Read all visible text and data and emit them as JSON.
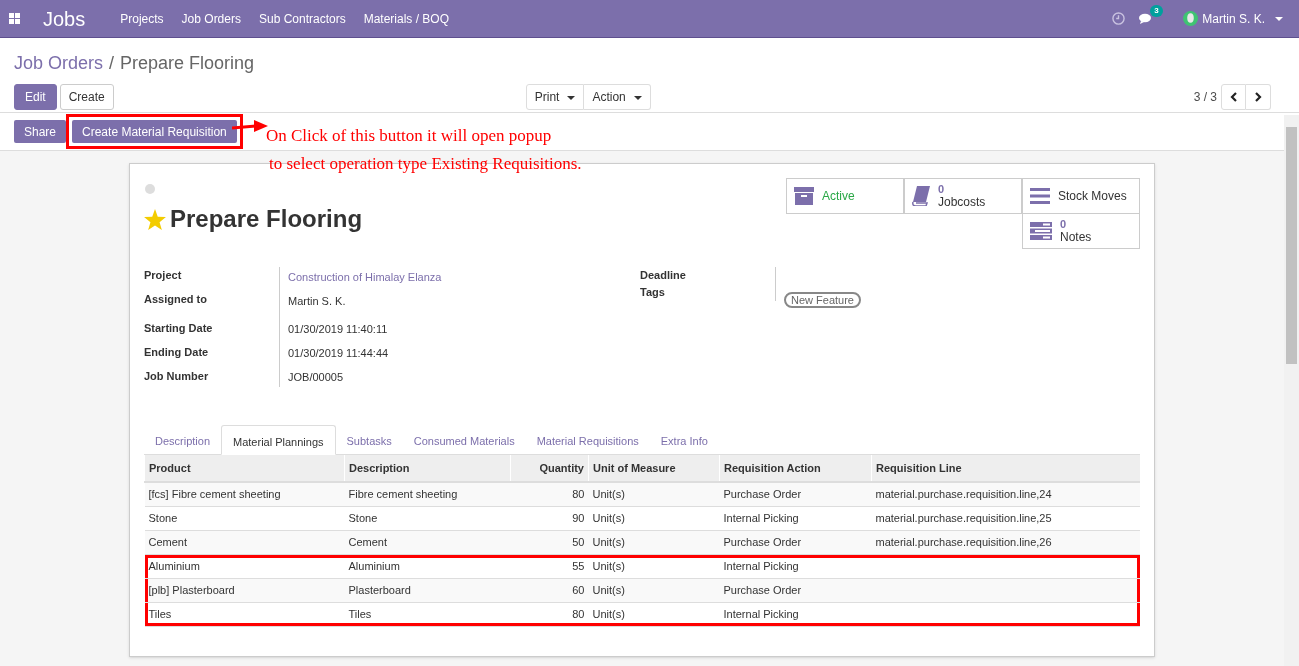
{
  "navbar": {
    "app_title": "Jobs",
    "menu": [
      "Projects",
      "Job Orders",
      "Sub Contractors",
      "Materials / BOQ"
    ],
    "message_count": "3",
    "user": "Martin S. K."
  },
  "breadcrumb": {
    "parent": "Job Orders",
    "separator": "/",
    "current": "Prepare Flooring"
  },
  "toolbar": {
    "edit": "Edit",
    "create": "Create",
    "print": "Print",
    "action": "Action",
    "pager": "3 / 3"
  },
  "statusbar": {
    "buttons": [
      {
        "label": "Share",
        "highlighted": false
      },
      {
        "label": "Create Material Requisition",
        "highlighted": true
      }
    ]
  },
  "annotation": {
    "lines": [
      "On Click of this button it will open popup",
      "to select operation type Existing Requisitions."
    ]
  },
  "form": {
    "title": "Prepare Flooring",
    "starred": true,
    "smart_buttons": [
      {
        "kind": "active",
        "label": "Active"
      },
      {
        "kind": "jobcosts",
        "count": "0",
        "label": "Jobcosts"
      },
      {
        "kind": "moves",
        "label": "Stock Moves"
      },
      {
        "kind": "notes",
        "count": "0",
        "label": "Notes"
      }
    ],
    "left_fields": [
      {
        "label": "Project",
        "value": "Construction of Himalay Elanza",
        "link": true
      },
      {
        "label": "Assigned to",
        "value": "Martin S. K.",
        "link": false
      },
      {
        "label": "Starting Date",
        "value": "01/30/2019 11:40:11",
        "link": false
      },
      {
        "label": "Ending Date",
        "value": "01/30/2019 11:44:44",
        "link": false
      },
      {
        "label": "Job Number",
        "value": "JOB/00005",
        "link": false
      }
    ],
    "right_fields": [
      {
        "label": "Deadline"
      },
      {
        "label": "Tags",
        "tag": "New Feature"
      }
    ],
    "tabs": [
      {
        "label": "Description",
        "selected": false
      },
      {
        "label": "Material Plannings",
        "selected": true
      },
      {
        "label": "Subtasks",
        "selected": false
      },
      {
        "label": "Consumed Materials",
        "selected": false
      },
      {
        "label": "Material Requisitions",
        "selected": false
      },
      {
        "label": "Extra Info",
        "selected": false
      }
    ],
    "table": {
      "columns": [
        "Product",
        "Description",
        "Quantity",
        "Unit of Measure",
        "Requisition Action",
        "Requisition Line"
      ],
      "rows": [
        {
          "cells": [
            "[fcs] Fibre cement sheeting",
            "Fibre cement sheeting",
            "80",
            "Unit(s)",
            "Purchase Order",
            "material.purchase.requisition.line,24"
          ],
          "highlighted": false
        },
        {
          "cells": [
            "Stone",
            "Stone",
            "90",
            "Unit(s)",
            "Internal Picking",
            "material.purchase.requisition.line,25"
          ],
          "highlighted": false
        },
        {
          "cells": [
            "Cement",
            "Cement",
            "50",
            "Unit(s)",
            "Purchase Order",
            "material.purchase.requisition.line,26"
          ],
          "highlighted": false
        },
        {
          "cells": [
            "Aluminium",
            "Aluminium",
            "55",
            "Unit(s)",
            "Internal Picking",
            ""
          ],
          "highlighted": true
        },
        {
          "cells": [
            "[plb] Plasterboard",
            "Plasterboard",
            "60",
            "Unit(s)",
            "Purchase Order",
            ""
          ],
          "highlighted": true
        },
        {
          "cells": [
            "Tiles",
            "Tiles",
            "80",
            "Unit(s)",
            "Internal Picking",
            ""
          ],
          "highlighted": true
        }
      ]
    }
  }
}
